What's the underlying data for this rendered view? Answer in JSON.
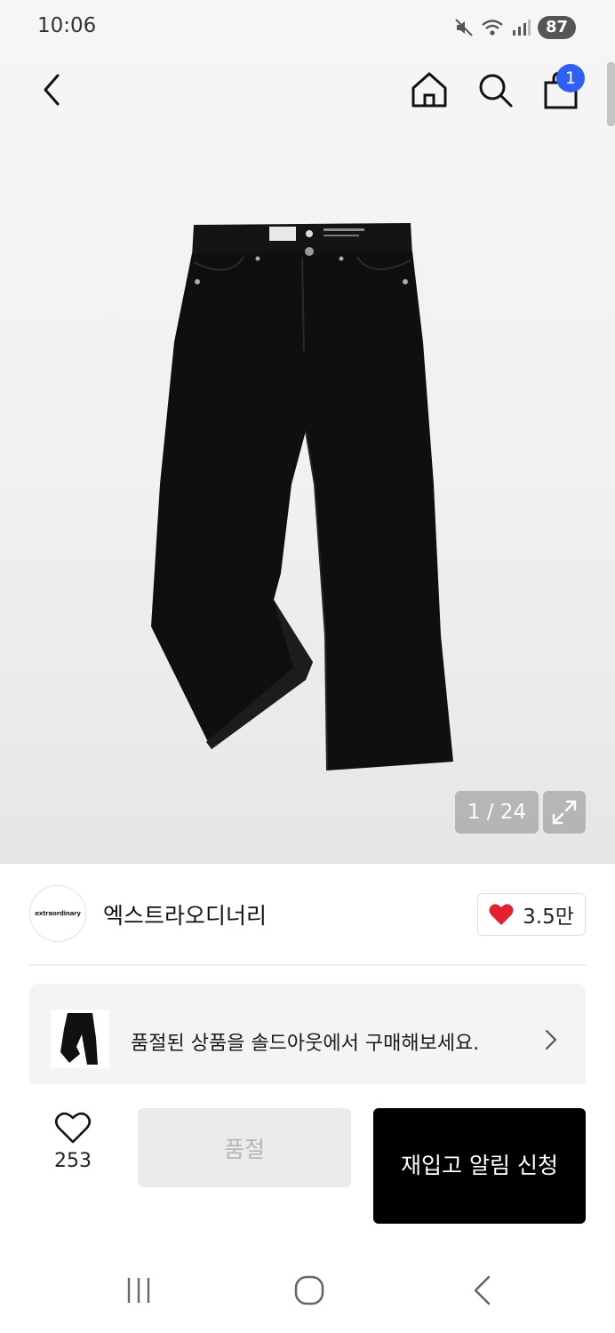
{
  "status_bar": {
    "time": "10:06",
    "battery": "87",
    "icons": [
      "mute-icon",
      "wifi-icon",
      "signal-icon"
    ]
  },
  "header": {
    "back": "back-icon",
    "home": "home-icon",
    "search": "search-icon",
    "cart": "shopping-bag-icon",
    "cart_badge": "1"
  },
  "gallery": {
    "counter": "1 / 24"
  },
  "brand": {
    "logo_text": "extraordinary",
    "name": "엑스트라오디너리",
    "likes": "3.5만"
  },
  "soldout_banner": {
    "text": "품절된 상품을 솔드아웃에서 구매해보세요."
  },
  "action_bar": {
    "wish_count": "253",
    "soldout_label": "품절",
    "restock_label": "재입고 알림 신청"
  },
  "colors": {
    "accent_blue": "#2f5ff5",
    "heart_red": "#e5202e",
    "primary_black": "#000000",
    "disabled_bg": "#ebebeb"
  }
}
